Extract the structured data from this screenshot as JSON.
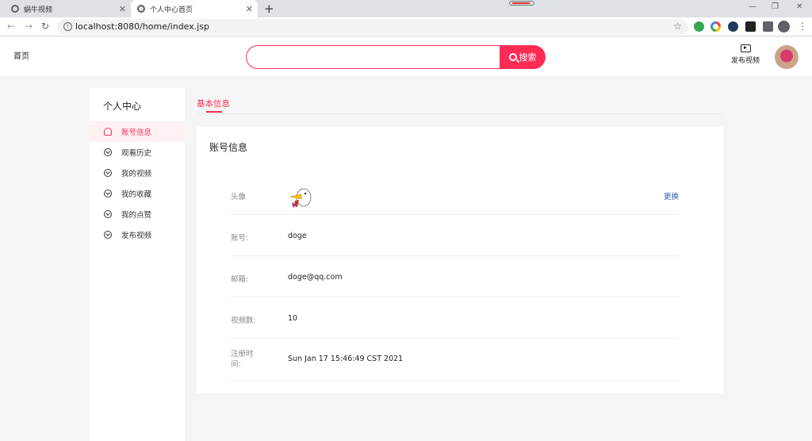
{
  "browser": {
    "tabs": [
      {
        "title": "蜗牛视频"
      },
      {
        "title": "个人中心首页"
      }
    ],
    "url": "localhost:8080/home/index.jsp"
  },
  "header": {
    "home_label": "首页",
    "search_button_label": "搜索",
    "search_value": "",
    "publish_label": "发布视频",
    "accent_color": "#fe2c55"
  },
  "sidebar": {
    "title": "个人中心",
    "items": [
      {
        "label": "账号信息",
        "icon": "user-icon",
        "active": true
      },
      {
        "label": "观看历史",
        "icon": "chevron-circle-icon"
      },
      {
        "label": "我的视频",
        "icon": "chevron-circle-icon"
      },
      {
        "label": "我的收藏",
        "icon": "chevron-circle-icon"
      },
      {
        "label": "我的点赞",
        "icon": "chevron-circle-icon"
      },
      {
        "label": "发布视频",
        "icon": "chevron-circle-icon"
      }
    ]
  },
  "main": {
    "tab_label": "基本信息",
    "card_title": "账号信息",
    "rows": {
      "avatar": {
        "label": "头像",
        "action": "更换"
      },
      "account": {
        "label": "账号:",
        "value": "doge"
      },
      "email": {
        "label": "邮箱:",
        "value": "doge@qq.com"
      },
      "video_count": {
        "label": "视频数:",
        "value": "10"
      },
      "register_time": {
        "label": "注册时间:",
        "value": "Sun Jan 17 15:46:49 CST 2021"
      }
    }
  }
}
